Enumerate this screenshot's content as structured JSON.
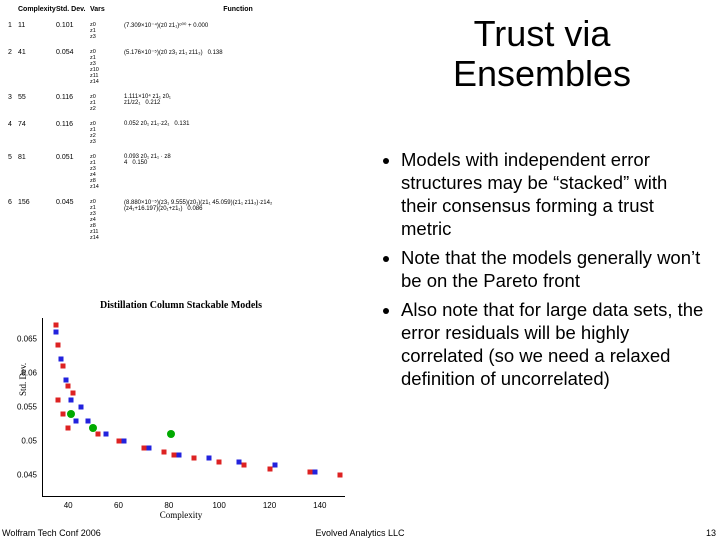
{
  "title": "Trust via Ensembles",
  "bullets": [
    "Models with independent error structures may be “stacked” with their consensus forming a trust metric",
    "Note that the models generally won’t be on the Pareto front",
    "Also note that for large data sets, the error residuals will be highly correlated (so we need a relaxed definition of uncorrelated)"
  ],
  "table": {
    "headers": {
      "complexity": "Complexity",
      "stddev": "Std. Dev.",
      "vars": "Vars",
      "function": "Function"
    },
    "rows": [
      {
        "n": "1",
        "cx": "11",
        "sd": "0.101",
        "vars": "z0\nz1\nz3",
        "fn": "(7.309×10⁻⁴)(z0 z1₁)ᵒ⁰⁰ + 0.000",
        "err": ""
      },
      {
        "n": "2",
        "cx": "41",
        "sd": "0.054",
        "vars": "z0\nz1\nz3\nz10\nz11\nz14",
        "fn": "(5.176×10⁻⁵)(z0  z3₁  z1₁  z11₃)",
        "err": "0.138"
      },
      {
        "n": "3",
        "cx": "55",
        "sd": "0.116",
        "vars": "z0\nz1\nz2",
        "fn": "1.111×10⁴ z1₁ z0₁\nz1/z2₁",
        "err": "0.212"
      },
      {
        "n": "4",
        "cx": "74",
        "sd": "0.116",
        "vars": "z0\nz1\nz2\nz3",
        "fn": "0.052 z0₁ z1₁·z2₁",
        "err": "0.131"
      },
      {
        "n": "5",
        "cx": "81",
        "sd": "0.051",
        "vars": "z0\nz1\nz3\nz4\nz8\nz14",
        "fn": "0.093 z0₁ z1₁ · z8\n4",
        "err": "0.150"
      },
      {
        "n": "6",
        "cx": "156",
        "sd": "0.045",
        "vars": "z0\nz1\nz3\nz4\nz8\nz11\nz14",
        "fn": "(8.880×10⁻⁵)(z3₁  9.555)(z0₁)(z1₁ 45.059)(z1₁  z11₃)·z14₂\n(z4₁+16.197)(z0₁+z1₁)",
        "err": "0.086"
      }
    ]
  },
  "chart_data": {
    "type": "scatter",
    "title": "Distillation Column Stackable Models",
    "xlabel": "Complexity",
    "ylabel": "Std. Dev.",
    "xlim": [
      30,
      150
    ],
    "ylim": [
      0.042,
      0.068
    ],
    "xticks": [
      40,
      60,
      80,
      100,
      120,
      140
    ],
    "yticks": [
      0.045,
      0.05,
      0.055,
      0.06,
      0.065
    ],
    "ytick_labels": [
      "0.045",
      "0.05",
      "0.055",
      "0.06",
      "0.065"
    ],
    "series": [
      {
        "name": "red",
        "marker": "square",
        "color": "#d22",
        "points": [
          [
            35,
            0.067
          ],
          [
            36,
            0.064
          ],
          [
            38,
            0.061
          ],
          [
            40,
            0.058
          ],
          [
            41,
            0.054
          ],
          [
            42,
            0.057
          ],
          [
            36,
            0.056
          ],
          [
            38,
            0.054
          ],
          [
            40,
            0.052
          ],
          [
            50,
            0.052
          ],
          [
            52,
            0.051
          ],
          [
            60,
            0.05
          ],
          [
            70,
            0.049
          ],
          [
            78,
            0.0485
          ],
          [
            82,
            0.048
          ],
          [
            90,
            0.0475
          ],
          [
            100,
            0.047
          ],
          [
            110,
            0.0465
          ],
          [
            120,
            0.046
          ],
          [
            136,
            0.0455
          ],
          [
            148,
            0.045
          ]
        ]
      },
      {
        "name": "blue",
        "marker": "square",
        "color": "#22d",
        "points": [
          [
            35,
            0.066
          ],
          [
            37,
            0.062
          ],
          [
            39,
            0.059
          ],
          [
            41,
            0.056
          ],
          [
            43,
            0.053
          ],
          [
            45,
            0.055
          ],
          [
            48,
            0.053
          ],
          [
            55,
            0.051
          ],
          [
            62,
            0.05
          ],
          [
            72,
            0.049
          ],
          [
            84,
            0.048
          ],
          [
            96,
            0.0475
          ],
          [
            108,
            0.047
          ],
          [
            122,
            0.0465
          ],
          [
            138,
            0.0455
          ]
        ]
      },
      {
        "name": "green",
        "marker": "circle",
        "color": "#0a0",
        "points": [
          [
            41,
            0.054
          ],
          [
            50,
            0.052
          ],
          [
            81,
            0.051
          ]
        ]
      }
    ]
  },
  "footer": {
    "left": "Wolfram Tech Conf 2006",
    "center": "Evolved Analytics LLC",
    "right": "13"
  }
}
